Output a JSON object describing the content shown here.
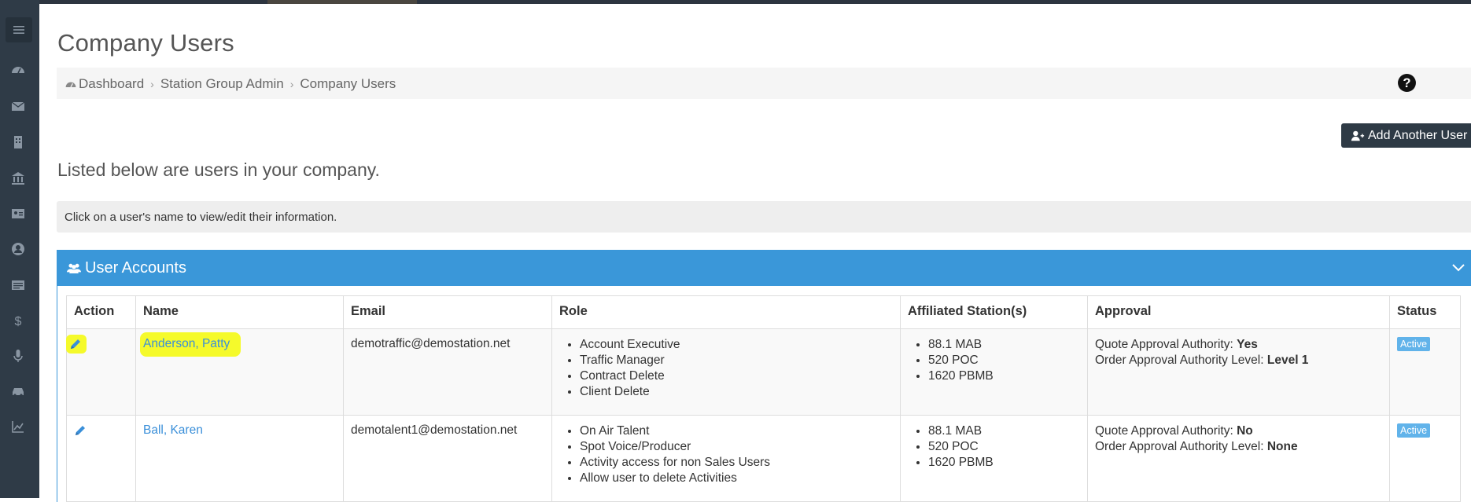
{
  "page": {
    "title": "Company Users",
    "breadcrumb": [
      "Dashboard",
      "Station Group Admin",
      "Company Users"
    ],
    "add_button": "Add Another User",
    "intro": "Listed below are users in your company.",
    "info": "Click on a user's name to view/edit their information."
  },
  "sidebar": {
    "icons": [
      "menu-icon",
      "dashboard-icon",
      "envelope-icon",
      "building-icon",
      "bank-icon",
      "id-card-icon",
      "user-circle-icon",
      "list-icon",
      "dollar-icon",
      "microphone-icon",
      "car-icon",
      "chart-icon"
    ]
  },
  "panel": {
    "title": "User Accounts",
    "columns": [
      "Action",
      "Name",
      "Email",
      "Role",
      "Affiliated Station(s)",
      "Approval",
      "Status"
    ],
    "rows": [
      {
        "name": "Anderson, Patty",
        "email": "demotraffic@demostation.net",
        "roles": [
          "Account Executive",
          "Traffic Manager",
          "Contract Delete",
          "Client Delete"
        ],
        "stations": [
          "88.1 MAB",
          "520 POC",
          "1620 PBMB"
        ],
        "quote_label": "Quote Approval Authority:",
        "quote_value": "Yes",
        "order_label": "Order Approval Authority Level:",
        "order_value": "Level 1",
        "status": "Active"
      },
      {
        "name": "Ball, Karen",
        "email": "demotalent1@demostation.net",
        "roles": [
          "On Air Talent",
          "Spot Voice/Producer",
          "Activity access for non Sales Users",
          "Allow user to delete Activities"
        ],
        "stations": [
          "88.1 MAB",
          "520 POC",
          "1620 PBMB"
        ],
        "quote_label": "Quote Approval Authority:",
        "quote_value": "No",
        "order_label": "Order Approval Authority Level:",
        "order_value": "None",
        "status": "Active"
      }
    ]
  },
  "colors": {
    "sidebar": "#2f3b47",
    "panel_header": "#3a97d9",
    "link": "#3a8fd9",
    "highlight": "#f5fa2b",
    "badge": "#61b3ea"
  }
}
